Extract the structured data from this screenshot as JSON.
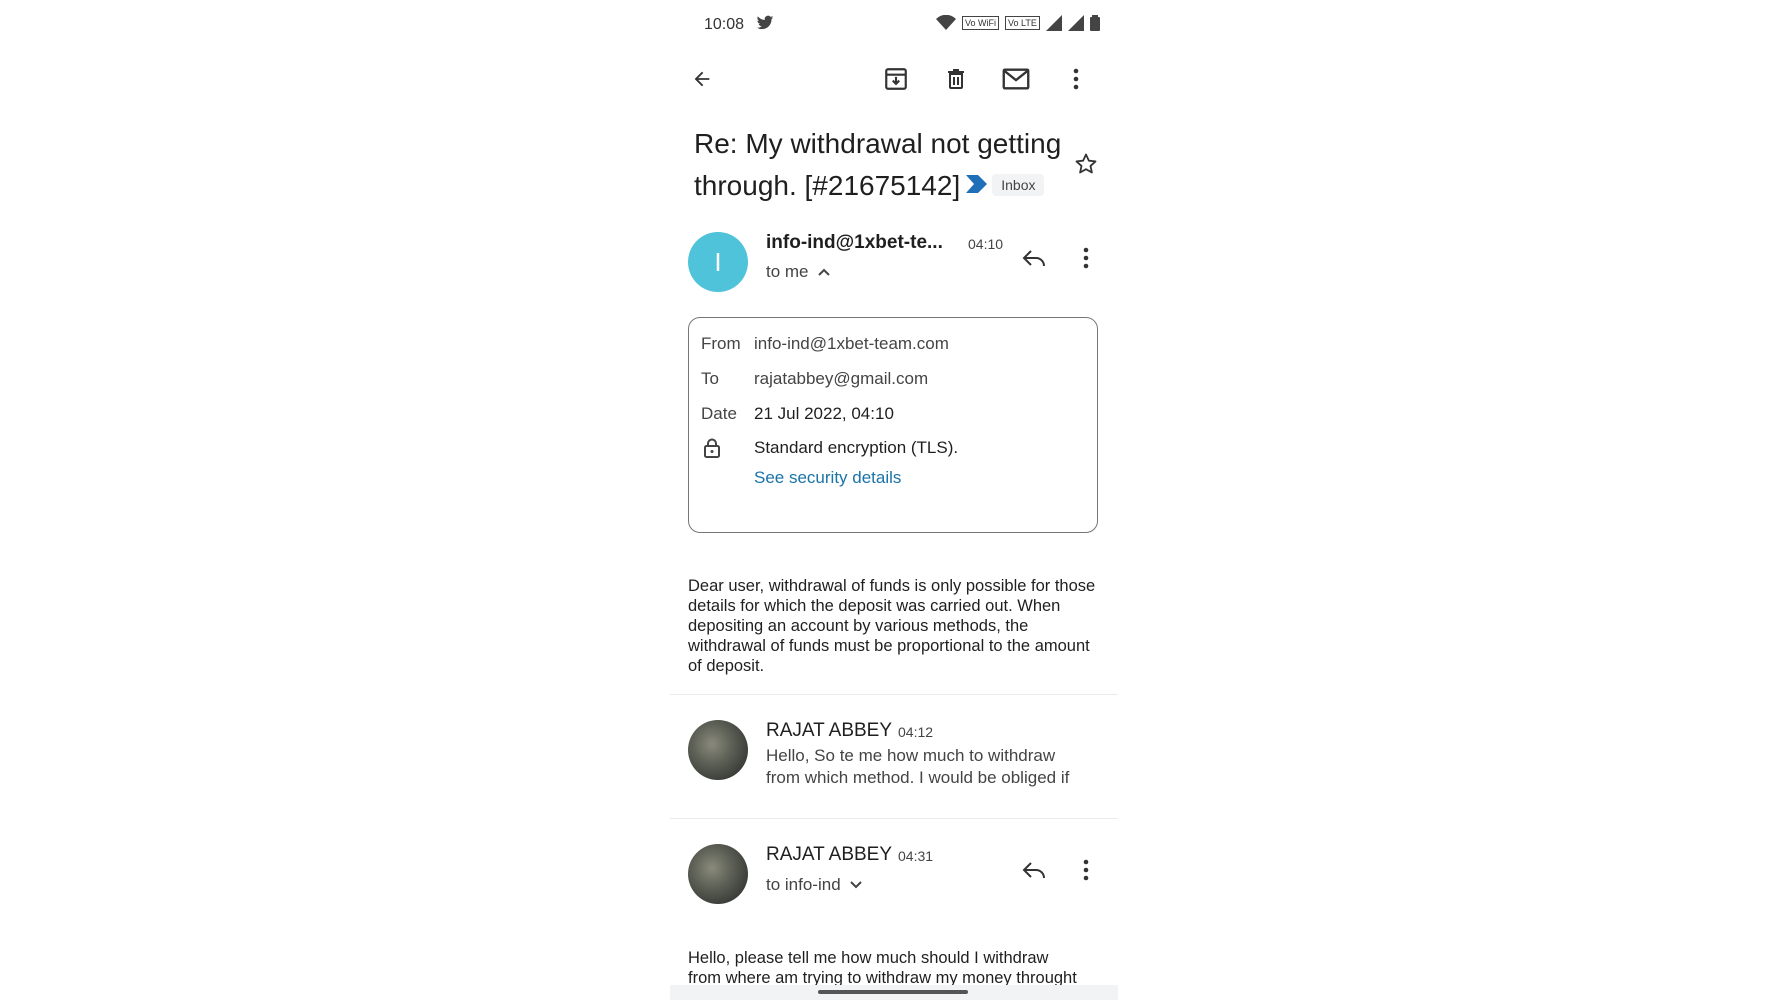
{
  "status_bar": {
    "time": "10:08",
    "vowifi1": "Vo WiFi",
    "vowifi2": "Vo LTE"
  },
  "toolbar": {
    "back_icon": "arrow-left-icon",
    "archive_icon": "archive-icon",
    "delete_icon": "trash-icon",
    "mark_unread_icon": "mail-icon",
    "more_icon": "more-vert-icon"
  },
  "subject": {
    "text": "Re: My withdrawal not getting through. [#21675142]",
    "label": "Inbox"
  },
  "message1": {
    "avatar_letter": "I",
    "sender": "info-ind@1xbet-te...",
    "time": "04:10",
    "recipient": "to me",
    "details": {
      "from_label": "From",
      "from_value": "info-ind@1xbet-team.com",
      "to_label": "To",
      "to_value": "rajatabbey@gmail.com",
      "date_label": "Date",
      "date_value": "21 Jul 2022, 04:10",
      "encryption": "Standard encryption (TLS).",
      "security_link": "See security details"
    },
    "body": "Dear user, withdrawal of funds is only possible for those details for which the deposit was carried out. When depositing an account by various methods, the withdrawal of funds must be proportional to the amount of deposit."
  },
  "message2": {
    "sender": "RAJAT ABBEY",
    "time": "04:12",
    "snippet_line1": "Hello, So te me how much to withdraw",
    "snippet_line2": "from which method. I would be obliged if"
  },
  "message3": {
    "sender": "RAJAT ABBEY",
    "time": "04:31",
    "recipient": "to info-ind",
    "body_line1": "Hello, please tell me how much should I withdraw",
    "body_line2": "from where am trying to withdraw my money throught"
  },
  "colors": {
    "avatar_teal": "#4fc3d9",
    "link_blue": "#1a73a8",
    "important_marker": "#1e6fb8"
  }
}
